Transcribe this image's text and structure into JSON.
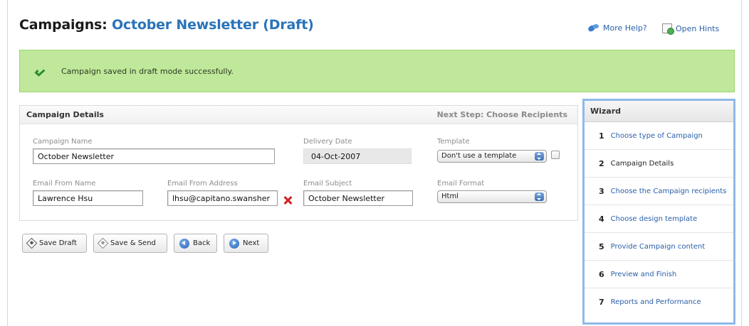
{
  "header": {
    "title_prefix": "Campaigns:",
    "title_name": "October Newsletter (Draft)",
    "more_help": "More Help?",
    "open_hints": "Open Hints"
  },
  "banner": {
    "message": "Campaign saved in draft mode successfully."
  },
  "details": {
    "title": "Campaign Details",
    "next_step": "Next Step: Choose Recipients",
    "fields": {
      "campaign_name": {
        "label": "Campaign Name",
        "value": "October Newsletter"
      },
      "delivery_date": {
        "label": "Delivery Date",
        "value": "04-Oct-2007"
      },
      "template": {
        "label": "Template",
        "value": "Don't use a template"
      },
      "from_name": {
        "label": "Email From Name",
        "value": "Lawrence Hsu"
      },
      "from_address": {
        "label": "Email From Address",
        "value": "lhsu@capitano.swansher"
      },
      "subject": {
        "label": "Email Subject",
        "value": "October Newsletter"
      },
      "format": {
        "label": "Email Format",
        "value": "Html"
      }
    }
  },
  "buttons": {
    "save_draft": "Save Draft",
    "save_send": "Save & Send",
    "back": "Back",
    "next": "Next"
  },
  "wizard": {
    "title": "Wizard",
    "steps": [
      {
        "num": "1",
        "label": "Choose type of Campaign"
      },
      {
        "num": "2",
        "label": "Campaign Details"
      },
      {
        "num": "3",
        "label": "Choose the Campaign recipients"
      },
      {
        "num": "4",
        "label": "Choose design template"
      },
      {
        "num": "5",
        "label": "Provide Campaign content"
      },
      {
        "num": "6",
        "label": "Preview and Finish"
      },
      {
        "num": "7",
        "label": "Reports and Performance"
      }
    ]
  },
  "colors": {
    "accent": "#2a73b8",
    "success_bg": "#bfe89a",
    "wizard_border": "#8fb9e8",
    "error": "#d42020"
  }
}
